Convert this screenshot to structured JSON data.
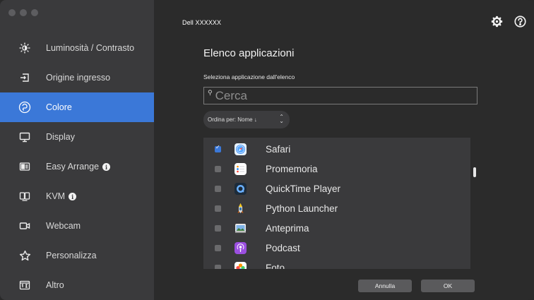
{
  "sidebar": {
    "items": [
      {
        "label": "Luminosità / Contrasto",
        "icon": "brightness-icon"
      },
      {
        "label": "Origine ingresso",
        "icon": "input-source-icon"
      },
      {
        "label": "Colore",
        "icon": "color-palette-icon",
        "active": true
      },
      {
        "label": "Display",
        "icon": "display-icon"
      },
      {
        "label": "Easy Arrange",
        "icon": "easy-arrange-icon",
        "info": true
      },
      {
        "label": "KVM",
        "icon": "kvm-icon",
        "info": true
      },
      {
        "label": "Webcam",
        "icon": "webcam-icon"
      },
      {
        "label": "Personalizza",
        "icon": "star-icon"
      },
      {
        "label": "Altro",
        "icon": "more-icon"
      }
    ]
  },
  "header": {
    "monitor_name": "Dell XXXXXX"
  },
  "main": {
    "title": "Elenco applicazioni",
    "subtitle": "Seleziona applicazione dall'elenco",
    "search_placeholder": "Cerca",
    "sort_label": "Ordina per: Nome ↓",
    "apps": [
      {
        "name": "Safari",
        "checked": true
      },
      {
        "name": "Promemoria",
        "checked": false
      },
      {
        "name": "QuickTime Player",
        "checked": false
      },
      {
        "name": "Python Launcher",
        "checked": false
      },
      {
        "name": "Anteprima",
        "checked": false
      },
      {
        "name": "Podcast",
        "checked": false
      },
      {
        "name": "Foto",
        "checked": false
      }
    ]
  },
  "buttons": {
    "cancel": "Annulla",
    "ok": "OK"
  },
  "colors": {
    "accent": "#3b78d8",
    "sidebar_bg": "#3a3a3c",
    "main_bg": "#2b2b2b"
  }
}
